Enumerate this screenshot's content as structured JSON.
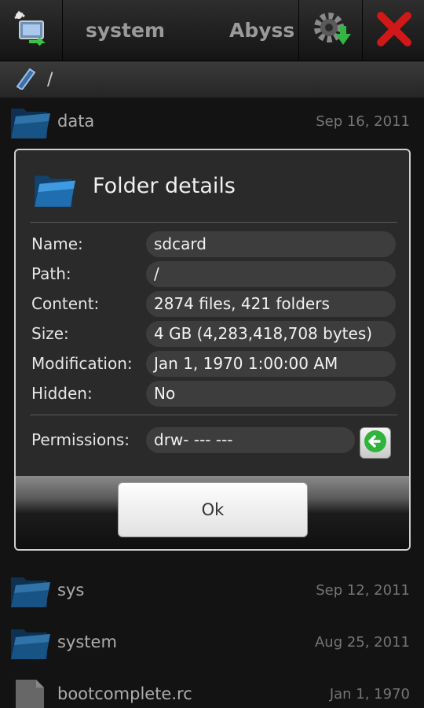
{
  "toolbar": {
    "tabs": [
      "system",
      "Abyss"
    ]
  },
  "breadcrumb": {
    "path": "/"
  },
  "files": [
    {
      "name": "data",
      "date": "Sep 16, 2011",
      "type": "folder"
    },
    {
      "name": "sys",
      "date": "Sep 12, 2011",
      "type": "folder"
    },
    {
      "name": "system",
      "date": "Aug 25, 2011",
      "type": "folder"
    },
    {
      "name": "bootcomplete.rc",
      "date": "Jan 1, 1970",
      "type": "file"
    }
  ],
  "dialog": {
    "title": "Folder details",
    "fields": [
      {
        "label": "Name:",
        "value": "sdcard"
      },
      {
        "label": "Path:",
        "value": "/"
      },
      {
        "label": "Content:",
        "value": "2874 files, 421 folders"
      },
      {
        "label": "Size:",
        "value": "4 GB (4,283,418,708 bytes)"
      },
      {
        "label": "Modification:",
        "value": "Jan 1, 1970 1:00:00 AM"
      },
      {
        "label": "Hidden:",
        "value": "No"
      }
    ],
    "permissions_label": "Permissions:",
    "permissions_value": "drw- --- ---",
    "ok_label": "Ok"
  },
  "colors": {
    "folder": "#1f6fb0",
    "close": "#d01818",
    "perm_button": "#2fb33a"
  },
  "icons": [
    "network-icon",
    "gear-download-icon",
    "close-icon",
    "device-icon",
    "folder-icon",
    "file-icon",
    "arrow-left-icon"
  ]
}
